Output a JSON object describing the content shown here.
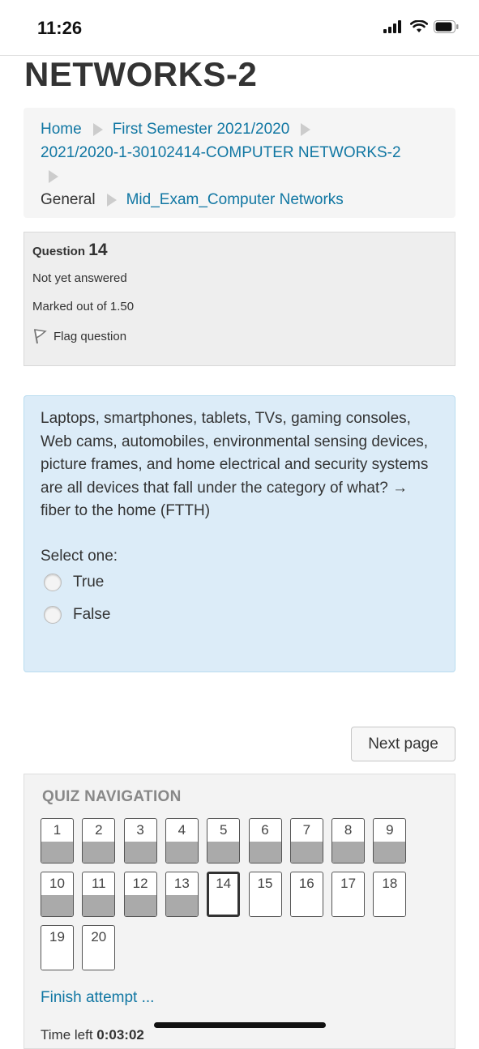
{
  "status_bar": {
    "time": "11:26"
  },
  "course": {
    "title": "NETWORKS-2"
  },
  "breadcrumb": {
    "home": "Home",
    "semester": "First Semester 2021/2020",
    "course_code": "2021/2020-1-30102414-COMPUTER NETWORKS-2",
    "section": "General",
    "quiz": "Mid_Exam_Computer Networks"
  },
  "question_info": {
    "label": "Question",
    "number": "14",
    "state": "Not yet answered",
    "grade": "Marked out of 1.50",
    "flag": "Flag question"
  },
  "question": {
    "text": "Laptops, smartphones, tablets, TVs, gaming consoles, Web cams, automobiles, environmental sensing devices, picture frames, and home electrical and security systems are all devices that fall under the category of what? → fiber to the home (FTTH)",
    "prompt": "Select one:",
    "options": [
      "True",
      "False"
    ]
  },
  "next_button": "Next page",
  "quiz_navigation": {
    "title": "QUIZ NAVIGATION",
    "buttons": [
      {
        "number": "1",
        "answered": true
      },
      {
        "number": "2",
        "answered": true
      },
      {
        "number": "3",
        "answered": true
      },
      {
        "number": "4",
        "answered": true
      },
      {
        "number": "5",
        "answered": true
      },
      {
        "number": "6",
        "answered": true
      },
      {
        "number": "7",
        "answered": true
      },
      {
        "number": "8",
        "answered": true
      },
      {
        "number": "9",
        "answered": true
      },
      {
        "number": "10",
        "answered": true
      },
      {
        "number": "11",
        "answered": true
      },
      {
        "number": "12",
        "answered": true
      },
      {
        "number": "13",
        "answered": true
      },
      {
        "number": "14",
        "answered": false,
        "current": true
      },
      {
        "number": "15",
        "answered": false
      },
      {
        "number": "16",
        "answered": false
      },
      {
        "number": "17",
        "answered": false
      },
      {
        "number": "18",
        "answered": false
      },
      {
        "number": "19",
        "answered": false
      },
      {
        "number": "20",
        "answered": false
      }
    ],
    "finish": "Finish attempt ...",
    "time_left_label": "Time left",
    "time_left_value": "0:03:02"
  }
}
